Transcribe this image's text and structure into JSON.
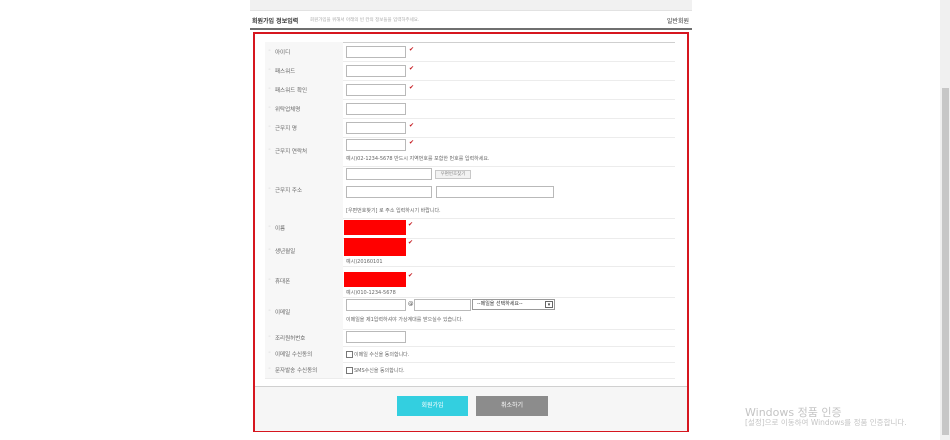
{
  "header": {
    "title": "회원가입 정보입력",
    "description": "회원가입을 위해서 아래의 빈 칸의 정보들을 입력하주세요.",
    "member_type": "일반회원"
  },
  "form": {
    "rows": [
      {
        "label": "아이디"
      },
      {
        "label": "패스워드"
      },
      {
        "label": "패스워드 확인"
      },
      {
        "label": "위탁업체명"
      },
      {
        "label": "근무지 명"
      },
      {
        "label": "근무지 연락처",
        "hint": "예시)02-1234-5678 반드시 지역번호를 포함한 번호를 입력하세요."
      },
      {
        "label": "근무지 주소",
        "button": "우편번호찾기",
        "hint": "[우편번호찾기] 로 주소 입력하시기 바랍니다."
      },
      {
        "label": "이름"
      },
      {
        "label": "생년월일",
        "hint": "예시)20160101"
      },
      {
        "label": "휴대폰",
        "hint": "예시)010-1234-5678"
      },
      {
        "label": "이메일",
        "at_symbol": "@",
        "select_value": "--메일을 선택하세요--",
        "hint": "이메일을 제1입력하셔야 가상계대를 받으실수 있습니다."
      },
      {
        "label": "조리원허번호"
      },
      {
        "label": "이메일 수신동의",
        "checkbox_label": "이메일 수신을 동의합니다."
      },
      {
        "label": "문자발송 수신동의",
        "checkbox_label": "SMS수신을 동의합니다."
      }
    ],
    "submit_label": "회원가입",
    "cancel_label": "취소하기"
  },
  "watermark": {
    "line1": "Windows 정품 인증",
    "line2": "[설정]으로 이동하여 Windows를 정품 인증합니다."
  },
  "colors": {
    "accent_border": "#d6161f",
    "submit_button": "#33cfe0",
    "cancel_button": "#8c8c8c",
    "redacted_field": "#ff0000",
    "required_mark": "#c4161c"
  },
  "icons": {
    "required": "check-mark",
    "select_arrow": "chevron-down"
  }
}
